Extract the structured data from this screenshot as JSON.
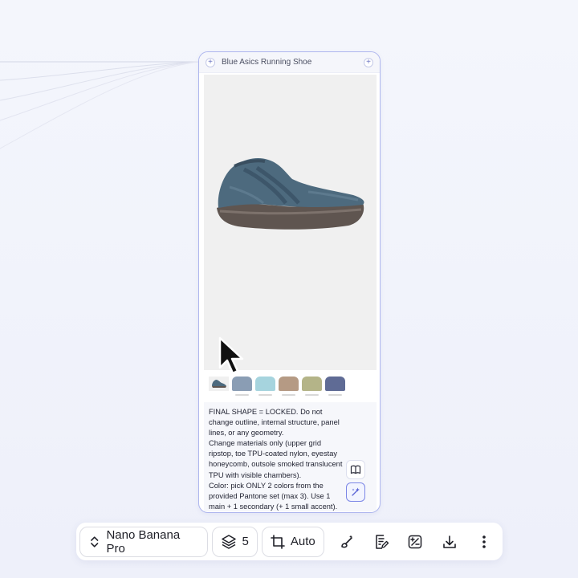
{
  "card": {
    "title": "Blue Asics Running Shoe",
    "image_icon": "sneaker-product-image",
    "swatch_colors": [
      "#8a9db4",
      "#a6d4de",
      "#b59a84",
      "#b4b488",
      "#5f6b95"
    ],
    "prompt": "FINAL SHAPE = LOCKED. Do not change outline, internal structure, panel lines, or any geometry.\nChange materials only (upper grid ripstop, toe TPU-coated nylon, eyestay honeycomb, outsole smoked translucent TPU with visible chambers).\nColor: pick ONLY 2 colors from the provided Pantone set (max 3). Use 1 main + 1 secondary (+ 1 small accent). Do not mix more colors.\nOrthographic side view, clean white background. No logos/text."
  },
  "toolbar": {
    "model_label": "Nano Banana Pro",
    "layers_count": "5",
    "aspect_label": "Auto"
  },
  "colors": {
    "accent": "#6a73c2",
    "card_border": "#aeb6ee"
  }
}
